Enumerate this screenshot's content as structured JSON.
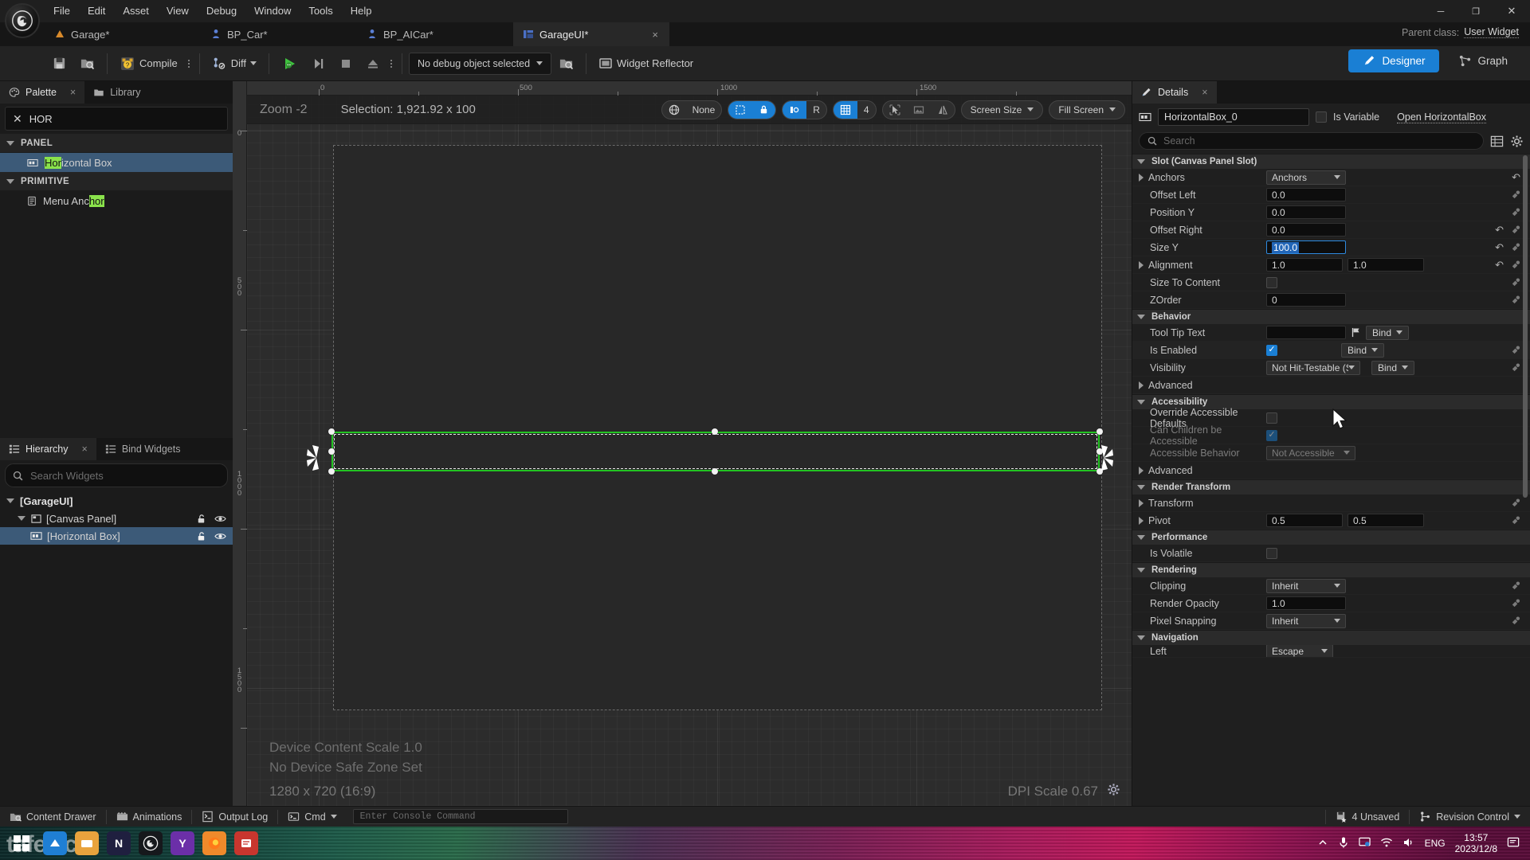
{
  "app": {
    "menu": [
      "File",
      "Edit",
      "Asset",
      "View",
      "Debug",
      "Window",
      "Tools",
      "Help"
    ],
    "window_controls": {
      "minimize": "─",
      "maximize": "❐",
      "close": "✕"
    }
  },
  "tabs": [
    {
      "label": "Garage*",
      "icon": "level-icon",
      "active": false
    },
    {
      "label": "BP_Car*",
      "icon": "blueprint-icon",
      "active": false
    },
    {
      "label": "BP_AICar*",
      "icon": "blueprint-icon",
      "active": false
    },
    {
      "label": "GarageUI*",
      "icon": "widget-icon",
      "active": true,
      "close": "×"
    }
  ],
  "parent_class": {
    "label": "Parent class:",
    "value": "User Widget"
  },
  "toolbar": {
    "save_label": "",
    "browse_label": "",
    "compile_label": "Compile",
    "diff_label": "Diff",
    "debug_object": "No debug object selected",
    "widget_reflector": "Widget Reflector",
    "designer": "Designer",
    "graph": "Graph"
  },
  "palette": {
    "tab_label": "Palette",
    "tab_close": "×",
    "library_tab": "Library",
    "search_value": "HOR",
    "clear_icon": "✕",
    "categories": [
      {
        "name": "PANEL",
        "items": [
          {
            "label_pre": "",
            "label_hl": "Hor",
            "label_post": "izontal Box",
            "selected": true
          }
        ]
      },
      {
        "name": "PRIMITIVE",
        "items": [
          {
            "label_pre": "Menu Anc",
            "label_hl": "hor",
            "label_post": "",
            "selected": false
          }
        ]
      }
    ]
  },
  "hierarchy": {
    "tab_label": "Hierarchy",
    "tab_close": "×",
    "bind_widgets_tab": "Bind Widgets",
    "search_placeholder": "Search Widgets",
    "search_value": "",
    "rows": [
      {
        "label": "[GarageUI]",
        "depth": 0,
        "selected": false,
        "has_icons": false,
        "expander": "down"
      },
      {
        "label": "[Canvas Panel]",
        "depth": 1,
        "selected": false,
        "has_icons": true,
        "expander": "down"
      },
      {
        "label": "[Horizontal Box]",
        "depth": 2,
        "selected": true,
        "has_icons": true,
        "expander": "none"
      }
    ]
  },
  "viewport": {
    "zoom_label": "Zoom -2",
    "selection_label": "Selection: 1,921.92 x 100",
    "none_label": "None",
    "grid_snap_value": "4",
    "rotation_label": "R",
    "screen_size": "Screen Size",
    "fill_screen": "Fill Screen",
    "ruler_top_ticks": [
      "0",
      "500",
      "1000",
      "1500"
    ],
    "ruler_left_ticks": [
      "0",
      "500",
      "1000",
      "1500"
    ],
    "device_content_scale": "Device Content Scale 1.0",
    "device_safe_zone": "No Device Safe Zone Set",
    "resolution": "1280 x 720 (16:9)",
    "dpi_scale": "DPI Scale 0.67"
  },
  "details": {
    "tab_label": "Details",
    "tab_close": "×",
    "widget_name": "HorizontalBox_0",
    "is_variable_label": "Is Variable",
    "is_variable_checked": false,
    "open_link": "Open HorizontalBox",
    "search_placeholder": "Search",
    "search_value": "",
    "sections": [
      {
        "title": "Slot (Canvas Panel Slot)",
        "rows": [
          {
            "name": "Anchors",
            "expander": true,
            "kind": "dropdown",
            "value": "Anchors",
            "revert": true,
            "bindpin": false
          },
          {
            "name": "Offset Left",
            "kind": "number",
            "value": "0.0",
            "revert": false,
            "bindpin": true
          },
          {
            "name": "Position Y",
            "kind": "number",
            "value": "0.0",
            "revert": false,
            "bindpin": true
          },
          {
            "name": "Offset Right",
            "kind": "number",
            "value": "0.0",
            "revert": true,
            "bindpin": true
          },
          {
            "name": "Size Y",
            "kind": "number",
            "value": "100.0",
            "selected": true,
            "revert": true,
            "bindpin": true
          },
          {
            "name": "Alignment",
            "expander": true,
            "kind": "number2",
            "value": "1.0",
            "value2": "1.0",
            "revert": true,
            "bindpin": true
          },
          {
            "name": "Size To Content",
            "kind": "checkbox",
            "checked": false,
            "revert": false,
            "bindpin": true
          },
          {
            "name": "ZOrder",
            "kind": "number",
            "value": "0",
            "revert": false,
            "bindpin": true
          }
        ]
      },
      {
        "title": "Behavior",
        "rows": [
          {
            "name": "Tool Tip Text",
            "kind": "text-bind",
            "value": "",
            "bind_label": "Bind",
            "revert": false,
            "bindpin": false
          },
          {
            "name": "Is Enabled",
            "kind": "checkbox-bind",
            "checked": true,
            "bind_label": "Bind",
            "revert": false,
            "bindpin": true
          },
          {
            "name": "Visibility",
            "kind": "dropdown-bind",
            "value": "Not Hit-Testable (Self C",
            "bind_label": "Bind",
            "revert": false,
            "bindpin": true
          },
          {
            "name": "Advanced",
            "kind": "collapsed",
            "expander": true
          }
        ]
      },
      {
        "title": "Accessibility",
        "rows": [
          {
            "name": "Override Accessible Defaults",
            "kind": "checkbox",
            "checked": false,
            "revert": false,
            "bindpin": false
          },
          {
            "name": "Can Children be Accessible",
            "kind": "checkbox",
            "checked": true,
            "dim": true,
            "revert": false,
            "bindpin": false
          },
          {
            "name": "Accessible Behavior",
            "kind": "dropdown",
            "value": "Not Accessible",
            "dim": true,
            "revert": false,
            "bindpin": false
          },
          {
            "name": "Advanced",
            "kind": "collapsed",
            "expander": true
          }
        ]
      },
      {
        "title": "Render Transform",
        "rows": [
          {
            "name": "Transform",
            "kind": "empty",
            "expander": true,
            "revert": false,
            "bindpin": true
          },
          {
            "name": "Pivot",
            "expander": true,
            "kind": "number2",
            "value": "0.5",
            "value2": "0.5",
            "revert": false,
            "bindpin": true
          }
        ]
      },
      {
        "title": "Performance",
        "rows": [
          {
            "name": "Is Volatile",
            "kind": "checkbox",
            "checked": false,
            "revert": false,
            "bindpin": false
          }
        ]
      },
      {
        "title": "Rendering",
        "rows": [
          {
            "name": "Clipping",
            "kind": "dropdown",
            "value": "Inherit",
            "revert": false,
            "bindpin": true
          },
          {
            "name": "Render Opacity",
            "kind": "number",
            "value": "1.0",
            "revert": false,
            "bindpin": true
          },
          {
            "name": "Pixel Snapping",
            "kind": "dropdown",
            "value": "Inherit",
            "revert": false,
            "bindpin": true
          }
        ]
      },
      {
        "title": "Navigation",
        "rows": [
          {
            "name": "Left",
            "kind": "dropdown",
            "value": "Escape",
            "revert": false,
            "bindpin": false
          }
        ]
      }
    ]
  },
  "statusbar": {
    "content_drawer": "Content Drawer",
    "animations": "Animations",
    "output_log": "Output Log",
    "cmd": "Cmd",
    "console_placeholder": "Enter Console Command",
    "unsaved": "4 Unsaved",
    "revision_control": "Revision Control"
  },
  "taskbar": {
    "language": "ENG",
    "time": "13:57",
    "date": "2023/12/8",
    "watermark": "tafe.cc"
  },
  "colors": {
    "accent_blue": "#1a7fd4",
    "selection_green": "#22c322",
    "highlight_green": "#8ae24b",
    "row_selected": "#3c5a78",
    "panel_bg": "#1f1f1f",
    "viewport_bg": "#2c2c2c"
  }
}
